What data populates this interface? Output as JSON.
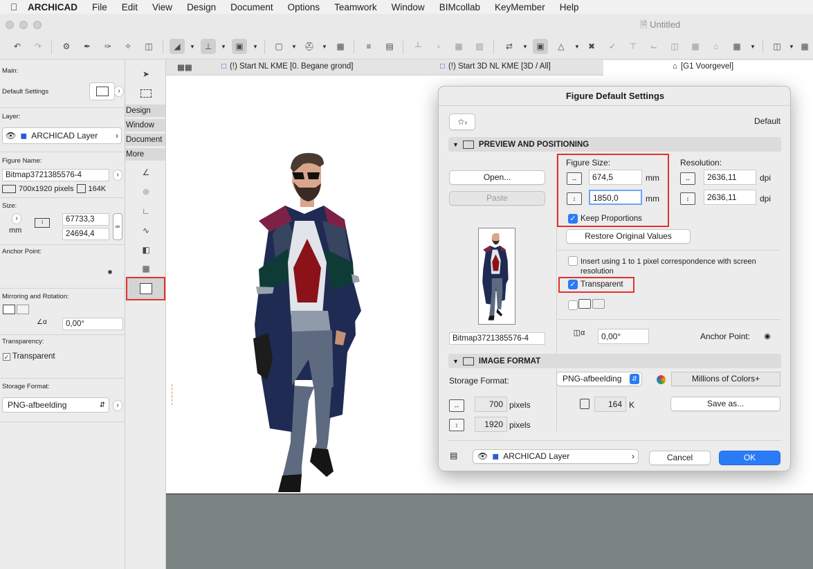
{
  "menubar": {
    "app": "ARCHICAD",
    "items": [
      "File",
      "Edit",
      "View",
      "Design",
      "Document",
      "Options",
      "Teamwork",
      "Window",
      "BIMcollab",
      "KeyMember",
      "Help"
    ]
  },
  "window": {
    "title": "Untitled"
  },
  "tabs": [
    {
      "label": "(!) Start NL KME [0. Begane grond]"
    },
    {
      "label": "(!) Start 3D NL KME [3D / All]"
    },
    {
      "label": "[G1 Voorgevel]"
    }
  ],
  "infobox": {
    "main_label": "Main:",
    "default_settings": "Default Settings",
    "layer_label": "Layer:",
    "layer_value": "ARCHICAD Layer",
    "figure_name_label": "Figure Name:",
    "figure_name": "Bitmap3721385576-4",
    "pixel_info": "700x1920 pixels",
    "size_info": "164K",
    "size_label": "Size:",
    "size_unit": "mm",
    "width_value": "67733,3",
    "height_value": "24694,4",
    "anchor_label": "Anchor Point:",
    "mirror_label": "Mirroring and Rotation:",
    "angle_value": "0,00°",
    "transparency_label": "Transparency:",
    "transparent": "Transparent",
    "storage_label": "Storage Format:",
    "storage_value": "PNG-afbeelding"
  },
  "toolbox": {
    "sections": [
      "Design",
      "Window",
      "Document",
      "More"
    ]
  },
  "dialog": {
    "title": "Figure Default Settings",
    "default_label": "Default",
    "section_preview": "PREVIEW AND POSITIONING",
    "open_button": "Open...",
    "paste_button": "Paste",
    "figure_size_label": "Figure Size:",
    "fig_width": "674,5",
    "fig_height": "1850,0",
    "unit_mm": "mm",
    "keep_proportions": "Keep Proportions",
    "resolution_label": "Resolution:",
    "res_x": "2636,11",
    "res_y": "2636,11",
    "unit_dpi": "dpi",
    "restore_button": "Restore Original Values",
    "insert_label": "Insert using 1 to 1 pixel correspondence with screen resolution",
    "transparent_label": "Transparent",
    "figure_name": "Bitmap3721385576-4",
    "angle": "0,00°",
    "anchor_label": "Anchor Point:",
    "section_format": "IMAGE FORMAT",
    "storage_label": "Storage Format:",
    "storage_value": "PNG-afbeelding",
    "colors_button": "Millions of Colors+",
    "px_width": "700",
    "px_height": "1920",
    "pixels": "pixels",
    "filesize": "164",
    "k_unit": "K",
    "save_as_button": "Save as...",
    "layer_value": "ARCHICAD Layer",
    "cancel_button": "Cancel",
    "ok_button": "OK"
  },
  "colors": {
    "accent": "#2a7bf6",
    "highlight": "#e03131",
    "ground": "#7b8482"
  }
}
